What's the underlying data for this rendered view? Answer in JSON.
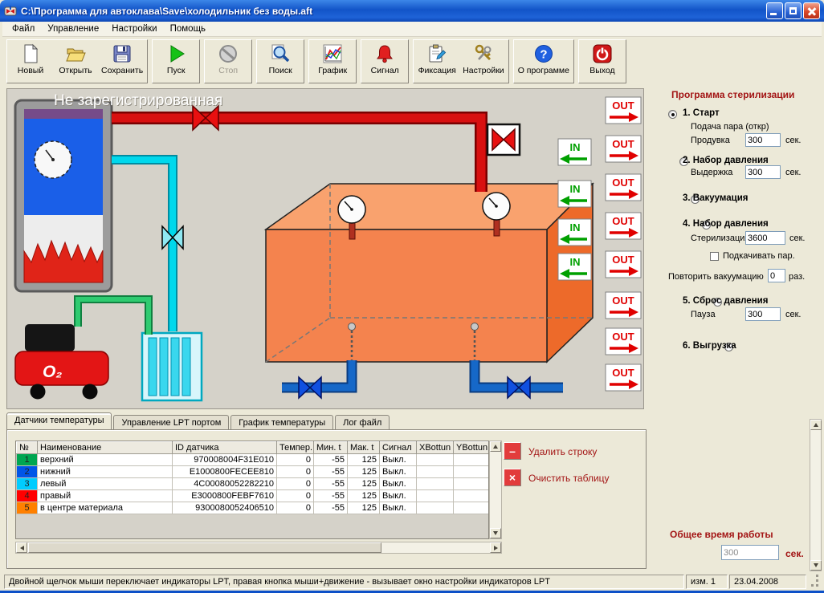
{
  "window": {
    "title": "C:\\Программа для автоклава\\Save\\холодильник без воды.aft"
  },
  "menu": {
    "items": [
      "Файл",
      "Управление",
      "Настройки",
      "Помощь"
    ]
  },
  "toolbar": {
    "buttons": [
      {
        "label": "Новый"
      },
      {
        "label": "Открыть"
      },
      {
        "label": "Сохранить"
      },
      {
        "label": "Пуск"
      },
      {
        "label": "Стоп"
      },
      {
        "label": "Поиск"
      },
      {
        "label": "График"
      },
      {
        "label": "Сигнал"
      },
      {
        "label": "Фиксация"
      },
      {
        "label": "Настройки"
      },
      {
        "label": "О программе"
      },
      {
        "label": "Выход"
      }
    ]
  },
  "icons": {
    "about_glyph": "?"
  },
  "watermark": "Не зарегистрированная",
  "diagram": {
    "in_label": "IN",
    "out_label": "OUT",
    "compressor_label": "O₂"
  },
  "program": {
    "title": "Программа стерилизации",
    "step1": {
      "label": "1. Старт",
      "note": "Подача пара (откр)",
      "field": "Продувка",
      "value": "300",
      "unit": "сек."
    },
    "step2": {
      "label": "2. Набор давления",
      "field": "Выдержка",
      "value": "300",
      "unit": "сек."
    },
    "step3": {
      "label": "3. Вакуумация"
    },
    "step4": {
      "label": "4. Набор давления",
      "field": "Стерилизация",
      "value": "3600",
      "unit": "сек.",
      "checkbox_label": "Подкачивать пар."
    },
    "repeat": {
      "label": "Повторить вакуумацию",
      "value": "0",
      "unit": "раз."
    },
    "step5": {
      "label": "5. Сброс давления",
      "field": "Пауза",
      "value": "300",
      "unit": "сек."
    },
    "step6": {
      "label": "6. Выгрузка"
    },
    "total": {
      "label": "Общее время работы",
      "value": "300",
      "unit": "сек."
    }
  },
  "tabs": [
    {
      "label": "Датчики температуры"
    },
    {
      "label": "Управление LPT портом"
    },
    {
      "label": "График температуры"
    },
    {
      "label": "Лог файл"
    }
  ],
  "table": {
    "columns": [
      "№",
      "Наименование",
      "ID датчика",
      "Темпер.",
      "Мин. t",
      "Мак. t",
      "Сигнал",
      "XBottun",
      "YBottun"
    ],
    "rows": [
      {
        "num": "1",
        "color": "#00A651",
        "name": "верхний",
        "id": "970008004F31E010",
        "temp": "0",
        "min": "-55",
        "max": "125",
        "signal": "Выкл.",
        "x": "",
        "y": ""
      },
      {
        "num": "2",
        "color": "#0055E8",
        "name": "нижний",
        "id": "E1000800FECEE810",
        "temp": "0",
        "min": "-55",
        "max": "125",
        "signal": "Выкл.",
        "x": "",
        "y": ""
      },
      {
        "num": "3",
        "color": "#00CCFF",
        "name": "левый",
        "id": "4C00080052282210",
        "temp": "0",
        "min": "-55",
        "max": "125",
        "signal": "Выкл.",
        "x": "",
        "y": ""
      },
      {
        "num": "4",
        "color": "#FF0000",
        "name": "правый",
        "id": "E3000800FEBF7610",
        "temp": "0",
        "min": "-55",
        "max": "125",
        "signal": "Выкл.",
        "x": "",
        "y": ""
      },
      {
        "num": "5",
        "color": "#FF8000",
        "name": "в центре материала",
        "id": "9300080052406510",
        "temp": "0",
        "min": "-55",
        "max": "125",
        "signal": "Выкл.",
        "x": "",
        "y": ""
      }
    ]
  },
  "actions": {
    "delete_row": "Удалить строку",
    "clear_table": "Очистить таблицу",
    "delete_glyph": "–",
    "clear_glyph": "×"
  },
  "statusbar": {
    "message": "Двойной щелчок мыши переключает индикаторы LPT, правая кнопка мыши+движение - вызывает окно настройки индикаторов LPT",
    "mod": "изм. 1",
    "date": "23.04.2008"
  }
}
